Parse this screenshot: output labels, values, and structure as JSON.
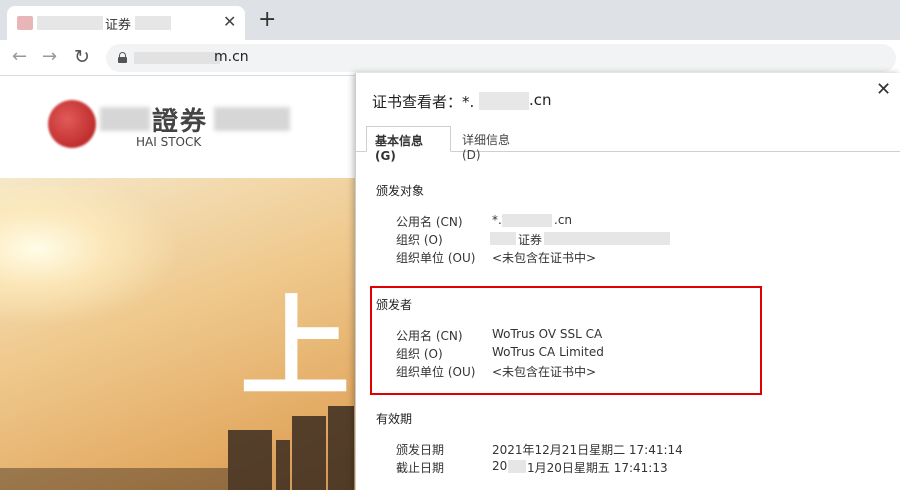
{
  "browser": {
    "tab_title": "证券",
    "url_tail": "m.cn"
  },
  "page": {
    "logo_text": "證券",
    "logo_sub": "HAI STOCK",
    "hero_char": "上"
  },
  "cert_viewer": {
    "title_prefix": "证书查看者：*.",
    "title_suffix": ".cn",
    "tabs": [
      "基本信息(G)",
      "详细信息(D)"
    ],
    "issued_to": {
      "heading": "颁发对象",
      "cn_label": "公用名 (CN)",
      "cn_value_prefix": "*.",
      "cn_value_suffix": ".cn",
      "o_label": "组织 (O)",
      "o_value": "证券",
      "ou_label": "组织单位 (OU)",
      "ou_value": "<未包含在证书中>"
    },
    "issued_by": {
      "heading": "颁发者",
      "cn_label": "公用名 (CN)",
      "cn_value": "WoTrus OV SSL CA",
      "o_label": "组织 (O)",
      "o_value": "WoTrus CA Limited",
      "ou_label": "组织单位 (OU)",
      "ou_value": "<未包含在证书中>"
    },
    "validity": {
      "heading": "有效期",
      "issue_label": "颁发日期",
      "issue_value": "2021年12月21日星期二 17:41:14",
      "expire_label": "截止日期",
      "expire_prefix": "20",
      "expire_suffix": "1月20日星期五 17:41:13"
    }
  }
}
